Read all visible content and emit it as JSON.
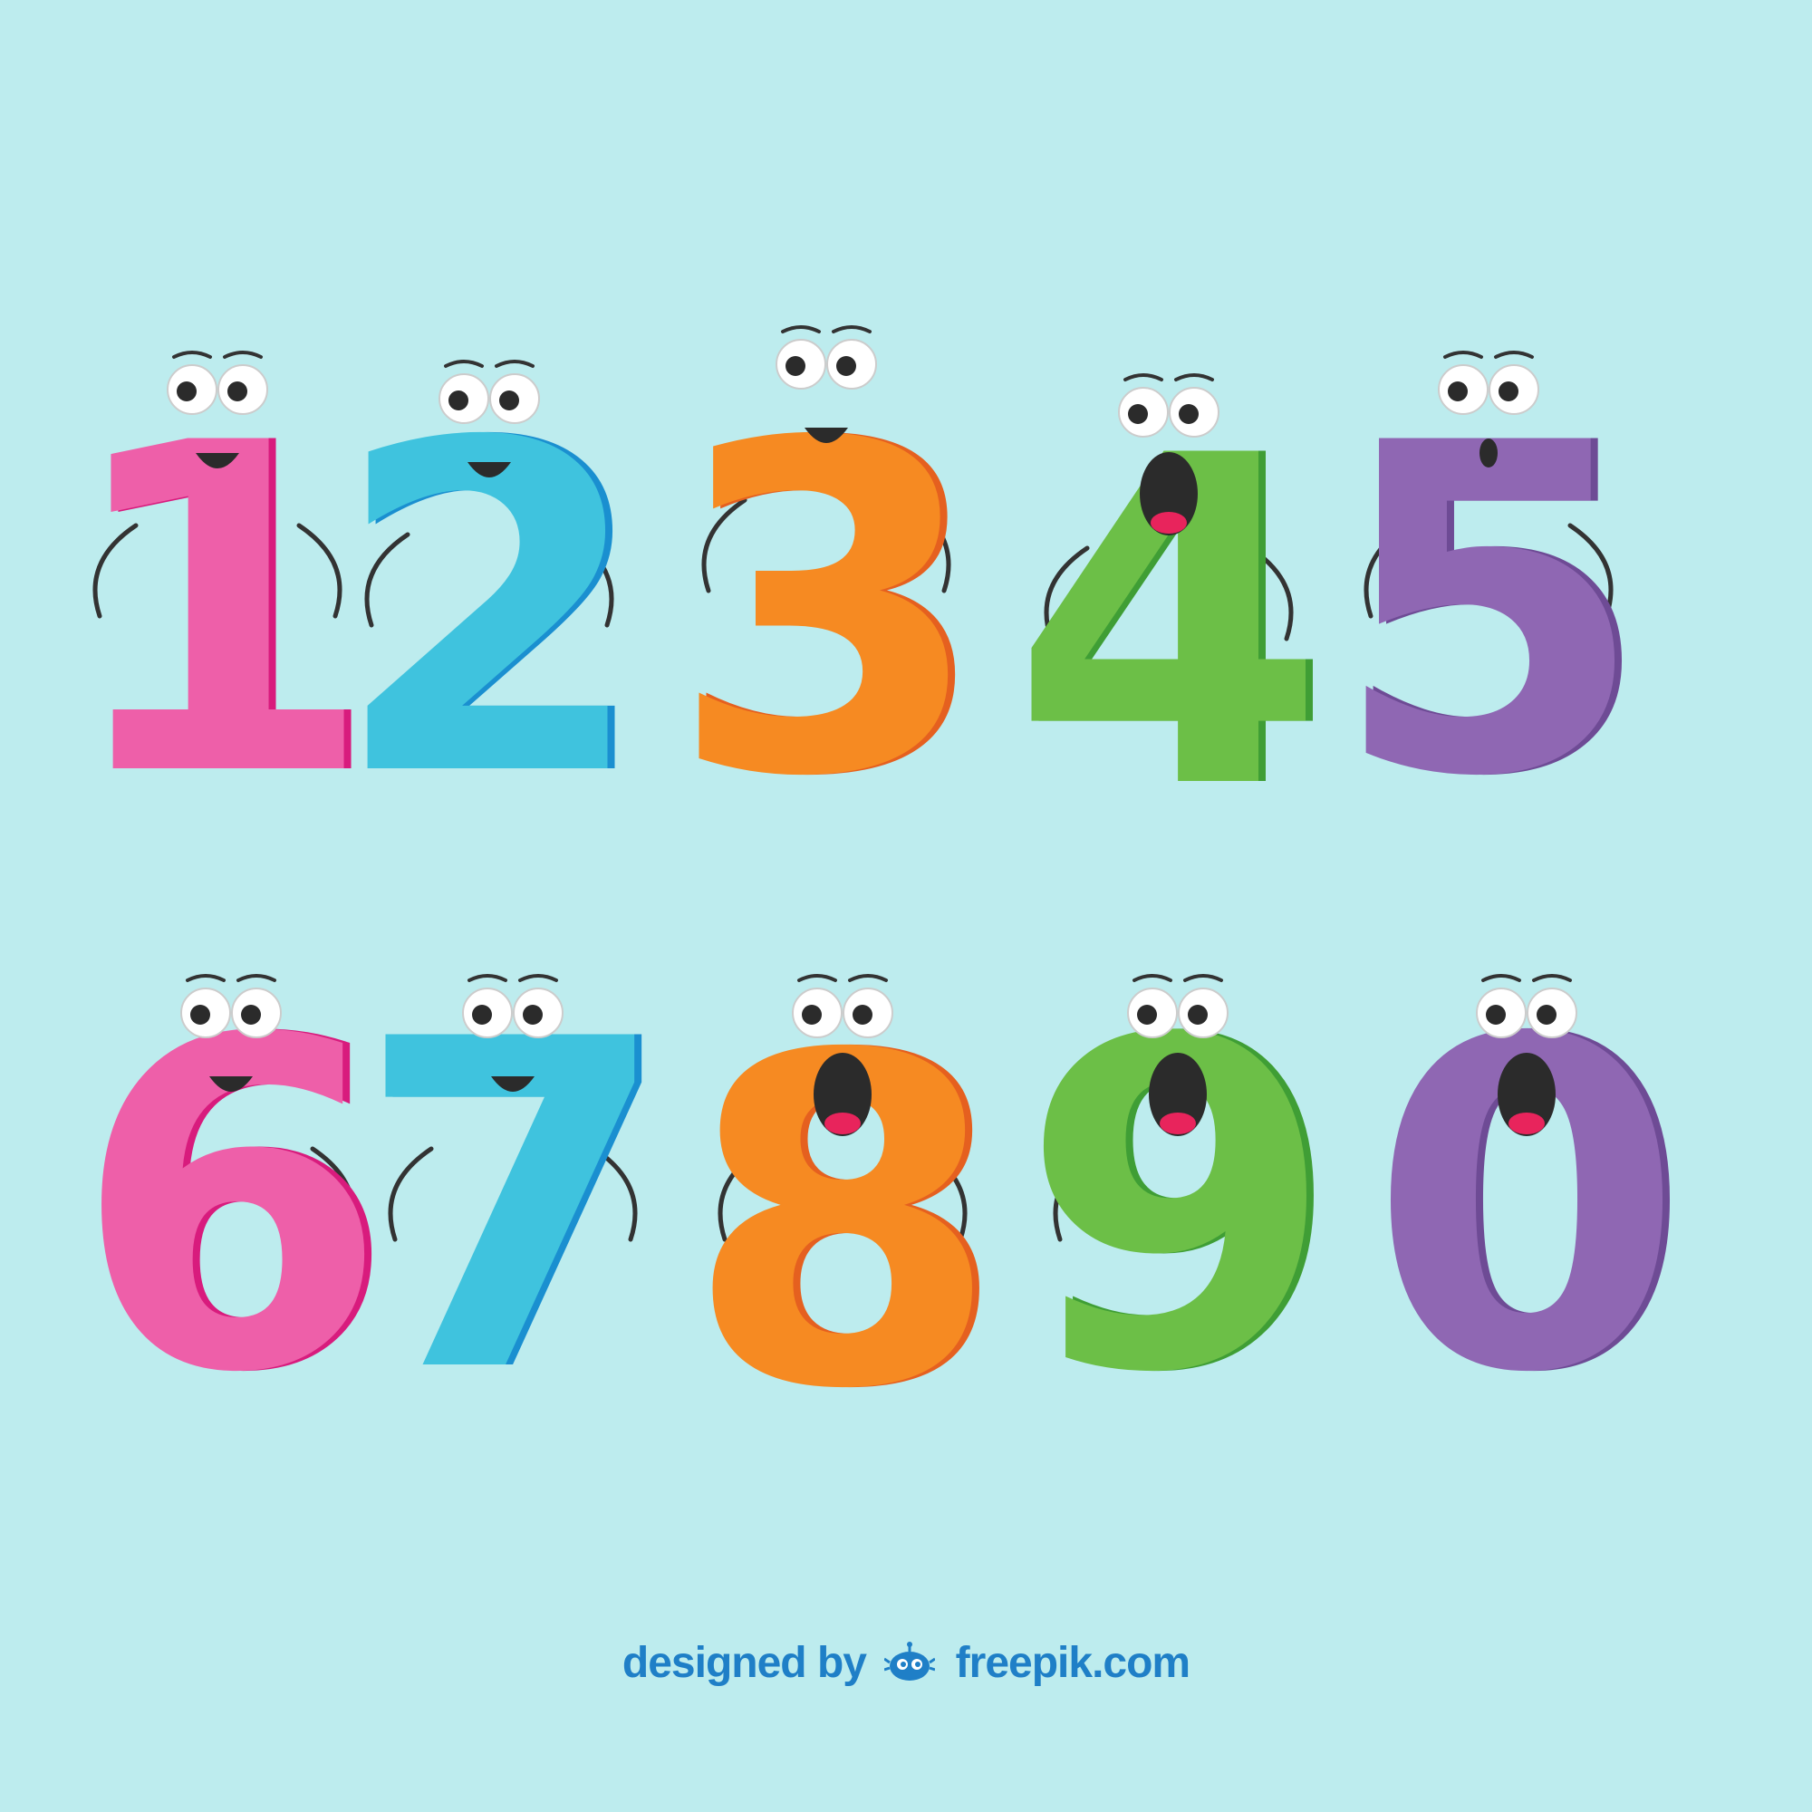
{
  "characters": [
    {
      "digit": "1",
      "color": "#ee5fa9",
      "shade": "#d81b7d"
    },
    {
      "digit": "2",
      "color": "#3fc3de",
      "shade": "#1a8fd0"
    },
    {
      "digit": "3",
      "color": "#f68a22",
      "shade": "#e5601f"
    },
    {
      "digit": "4",
      "color": "#6cbf47",
      "shade": "#3f9e35"
    },
    {
      "digit": "5",
      "color": "#8f67b3",
      "shade": "#6e4b95"
    },
    {
      "digit": "6",
      "color": "#ee5fa9",
      "shade": "#d81b7d"
    },
    {
      "digit": "7",
      "color": "#3fc3de",
      "shade": "#1a8fd0"
    },
    {
      "digit": "8",
      "color": "#f68a22",
      "shade": "#e5601f"
    },
    {
      "digit": "9",
      "color": "#6cbf47",
      "shade": "#3f9e35"
    },
    {
      "digit": "0",
      "color": "#8f67b3",
      "shade": "#6e4b95"
    }
  ],
  "credit": {
    "prefix": "designed by",
    "brand": "freepik.com",
    "color": "#1f7fc7"
  },
  "background_color": "#bdecee"
}
